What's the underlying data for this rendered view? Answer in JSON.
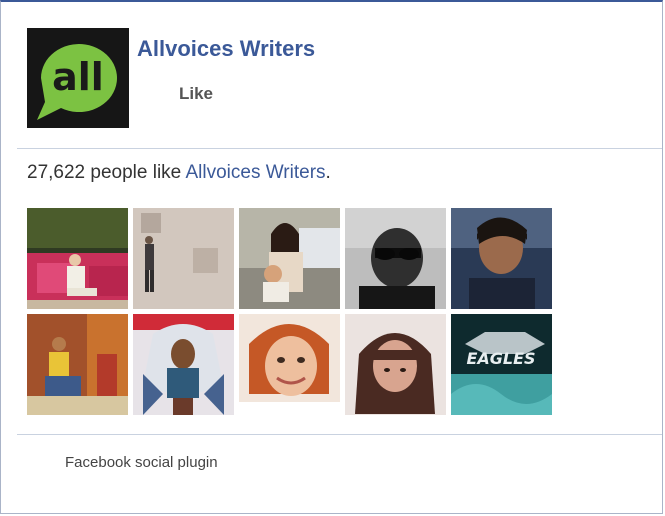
{
  "page": {
    "name": "Allvoices Writers",
    "logo_text": "all",
    "like_label": "Like"
  },
  "fans": {
    "count_text": "27,622 people like ",
    "page_link": "Allvoices Writers",
    "suffix": ".",
    "faces": [
      {
        "name": "fan-avatar-1",
        "palette": "garden"
      },
      {
        "name": "fan-avatar-2",
        "palette": "wall"
      },
      {
        "name": "fan-avatar-3",
        "palette": "mother"
      },
      {
        "name": "fan-avatar-4",
        "palette": "sunglasses"
      },
      {
        "name": "fan-avatar-5",
        "palette": "portrait"
      },
      {
        "name": "fan-avatar-6",
        "palette": "room"
      },
      {
        "name": "fan-avatar-7",
        "palette": "comic"
      },
      {
        "name": "fan-avatar-8",
        "palette": "redhead"
      },
      {
        "name": "fan-avatar-9",
        "palette": "brunette"
      },
      {
        "name": "fan-avatar-10",
        "palette": "eagles"
      }
    ]
  },
  "footer": {
    "label": "Facebook social plugin"
  }
}
